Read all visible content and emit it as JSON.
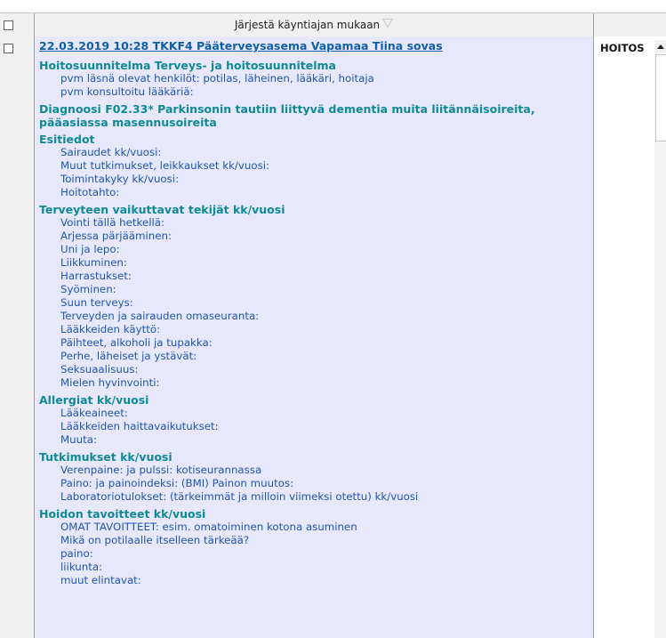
{
  "header": {
    "sort_label": "Järjestä käyntiajan mukaan"
  },
  "entry": {
    "title": "22.03.2019 10:28 TKKF4 Pääterveysasema Vapamaa Tiina sovas",
    "sections": [
      {
        "heading": "Hoitosuunnitelma  Terveys- ja hoitosuunnitelma",
        "lines": [
          "pvm läsnä olevat henkilöt: potilas, läheinen, lääkäri, hoitaja",
          "pvm konsultoitu lääkäriä:"
        ]
      },
      {
        "heading": "Diagnoosi F02.33* Parkinsonin tautiin liittyvä dementia  muita liitännäisoireita, pääasiassa masennusoireita",
        "lines": []
      },
      {
        "heading": "Esitiedot",
        "lines": [
          "Sairaudet kk/vuosi:",
          "Muut tutkimukset, leikkaukset kk/vuosi:",
          "Toimintakyky kk/vuosi:",
          "Hoitotahto:"
        ]
      },
      {
        "heading": "Terveyteen vaikuttavat tekijät  kk/vuosi",
        "lines": [
          "Vointi tällä hetkellä:",
          "Arjessa pärjääminen:",
          "Uni ja lepo:",
          "Liikkuminen:",
          "Harrastukset:",
          "Syöminen:",
          "Suun terveys:",
          "Terveyden ja sairauden omaseuranta:",
          "Lääkkeiden käyttö:",
          "Päihteet, alkoholi ja tupakka:",
          "Perhe, läheiset ja ystävät:",
          "Seksuaalisuus:",
          "Mielen hyvinvointi:"
        ]
      },
      {
        "heading": "Allergiat  kk/vuosi",
        "lines": [
          "Lääkeaineet:",
          "Lääkkeiden haittavaikutukset:",
          "Muuta:"
        ]
      },
      {
        "heading": "Tutkimukset  kk/vuosi",
        "lines": [
          "Verenpaine:  ja pulssi:  kotiseurannassa",
          "Paino:  ja painoindeksi:  (BMI) Painon muutos:",
          "Laboratoriotulokset: (tärkeimmät ja milloin viimeksi otettu) kk/vuosi"
        ]
      },
      {
        "heading": "Hoidon tavoitteet  kk/vuosi",
        "lines": [
          "OMAT TAVOITTEET: esim. omatoiminen kotona asuminen",
          "Mikä on potilaalle itselleen tärkeää?",
          "paino:",
          "liikunta:",
          "muut elintavat:"
        ]
      }
    ]
  },
  "right_panel": {
    "label": "HOITOS"
  }
}
